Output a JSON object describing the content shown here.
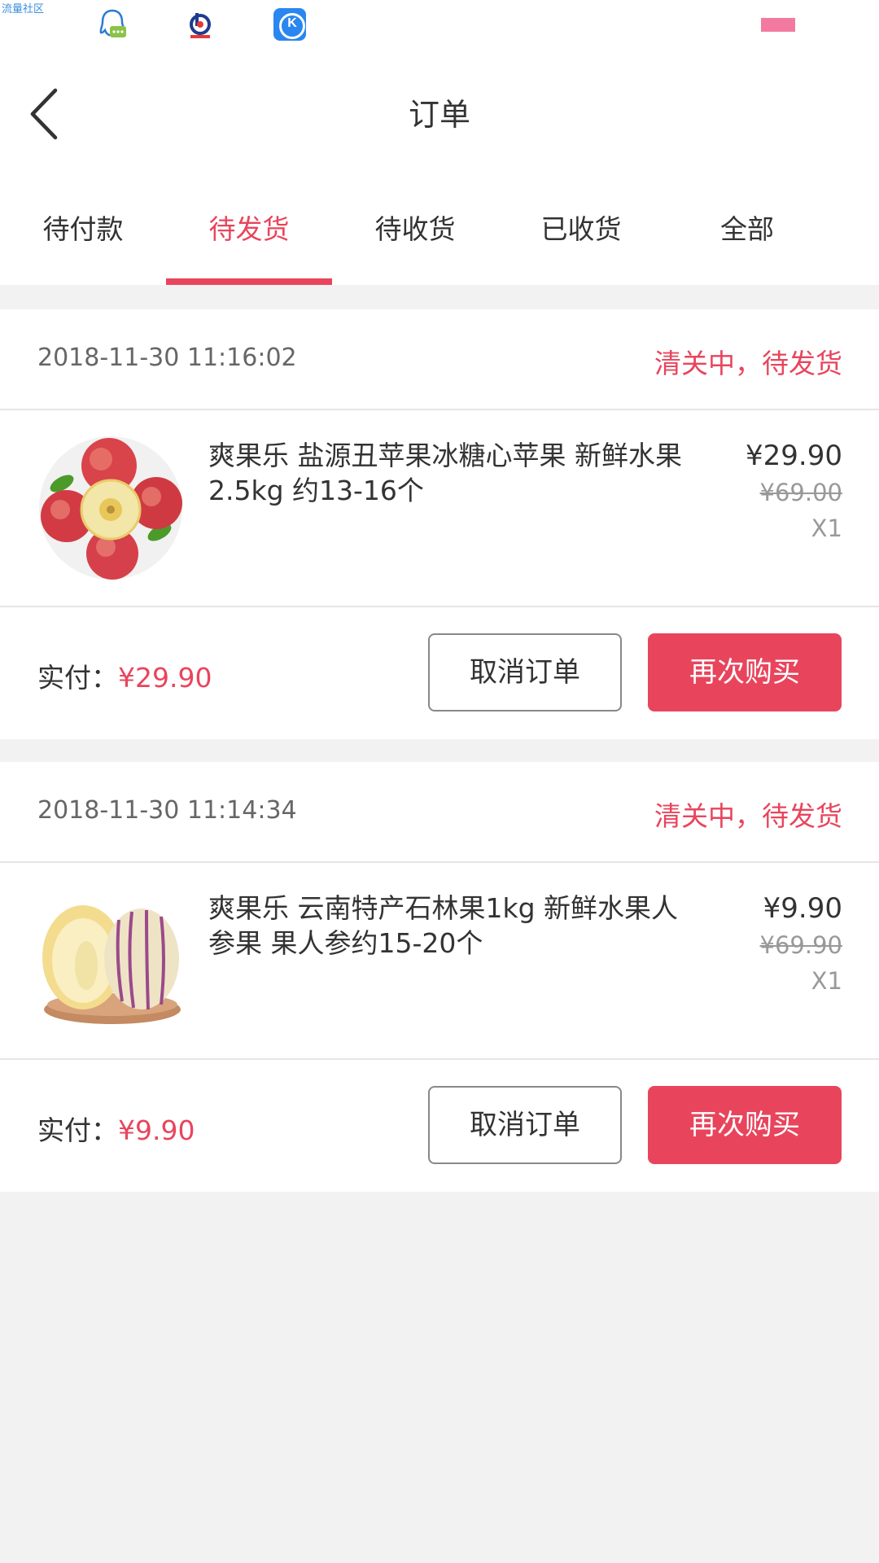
{
  "status_bar": {
    "watermark": "流量社区",
    "icons": [
      "qq-message-icon",
      "baidu-app-icon",
      "kugou-icon",
      "battery-icon"
    ]
  },
  "header": {
    "title": "订单",
    "back_icon": "chevron-left-icon"
  },
  "tabs": [
    {
      "label": "待付款",
      "active": false
    },
    {
      "label": "待发货",
      "active": true
    },
    {
      "label": "待收货",
      "active": false
    },
    {
      "label": "已收货",
      "active": false
    },
    {
      "label": "全部",
      "active": false
    }
  ],
  "orders": [
    {
      "time": "2018-11-30 11:16:02",
      "status": "清关中，待发货",
      "item": {
        "name": "爽果乐 盐源丑苹果冰糖心苹果 新鲜水果 2.5kg 约13-16个",
        "price": "¥29.90",
        "original_price": "¥69.00",
        "quantity": "X1",
        "image": "apple-image"
      },
      "paid_label": "实付：",
      "paid_amount": "¥29.90",
      "cancel_label": "取消订单",
      "rebuy_label": "再次购买"
    },
    {
      "time": "2018-11-30 11:14:34",
      "status": "清关中，待发货",
      "item": {
        "name": "爽果乐 云南特产石林果1kg 新鲜水果人参果 果人参约15-20个",
        "price": "¥9.90",
        "original_price": "¥69.90",
        "quantity": "X1",
        "image": "pepino-melon-image"
      },
      "paid_label": "实付：",
      "paid_amount": "¥9.90",
      "cancel_label": "取消订单",
      "rebuy_label": "再次购买"
    }
  ],
  "colors": {
    "accent": "#e8455d",
    "background": "#f2f2f2",
    "text": "#333333",
    "muted": "#999999"
  }
}
